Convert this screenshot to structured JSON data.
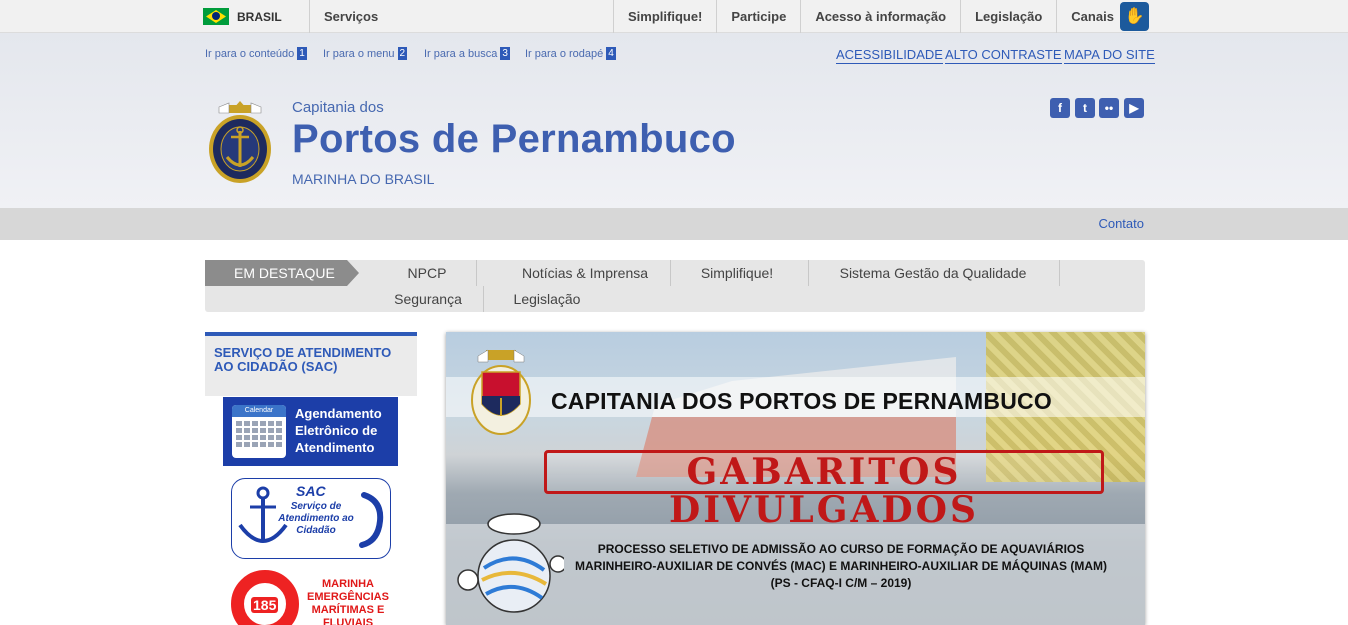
{
  "govbar": {
    "country": "BRASIL",
    "servicos": "Serviços",
    "menu": [
      "Simplifique!",
      "Participe",
      "Acesso à informação",
      "Legislação",
      "Canais"
    ]
  },
  "skiplinks": [
    {
      "label": "Ir para o conteúdo",
      "num": "1"
    },
    {
      "label": "Ir para o menu",
      "num": "2"
    },
    {
      "label": "Ir para a busca",
      "num": "3"
    },
    {
      "label": "Ir para o rodapé",
      "num": "4"
    }
  ],
  "accessibility": [
    "ACESSIBILIDADE",
    "ALTO CONTRASTE",
    "MAPA DO SITE"
  ],
  "header": {
    "pre_title": "Capitania dos",
    "title": "Portos de Pernambuco",
    "subtitle": "MARINHA DO BRASIL"
  },
  "social": [
    "facebook-icon",
    "twitter-icon",
    "flickr-icon",
    "youtube-icon"
  ],
  "contato": "Contato",
  "nav": {
    "highlight": "EM DESTAQUE",
    "items": [
      "NPCP",
      "Notícias & Imprensa",
      "Simplifique!",
      "Sistema Gestão da Qualidade",
      "Segurança",
      "Legislação"
    ]
  },
  "sidebar": {
    "sac_title": "SERVIÇO DE ATENDIMENTO AO CIDADÃO (SAC)",
    "calendar_header": "Calendar",
    "agendamento": "Agendamento Eletrônico de Atendimento",
    "sac_label": "SAC",
    "sac_sub": "Serviço de Atendimento ao Cidadão",
    "emerg_num": "185",
    "emerg_label": "MARINHA EMERGÊNCIAS MARÍTIMAS E FLUVIAIS"
  },
  "hero": {
    "title": "CAPITANIA DOS PORTOS DE PERNAMBUCO",
    "headline": "GABARITOS DIVULGADOS",
    "line1": "PROCESSO SELETIVO DE ADMISSÃO AO CURSO DE FORMAÇÃO DE AQUAVIÁRIOS",
    "line2": "MARINHEIRO-AUXILIAR DE CONVÉS (MAC) E MARINHEIRO-AUXILIAR DE MÁQUINAS (MAM)",
    "line3": "(PS - CFAQ-I C/M – 2019)"
  },
  "colors": {
    "brand": "#3e5fb0",
    "link": "#2e5ab8",
    "alert_red": "#c01818"
  }
}
